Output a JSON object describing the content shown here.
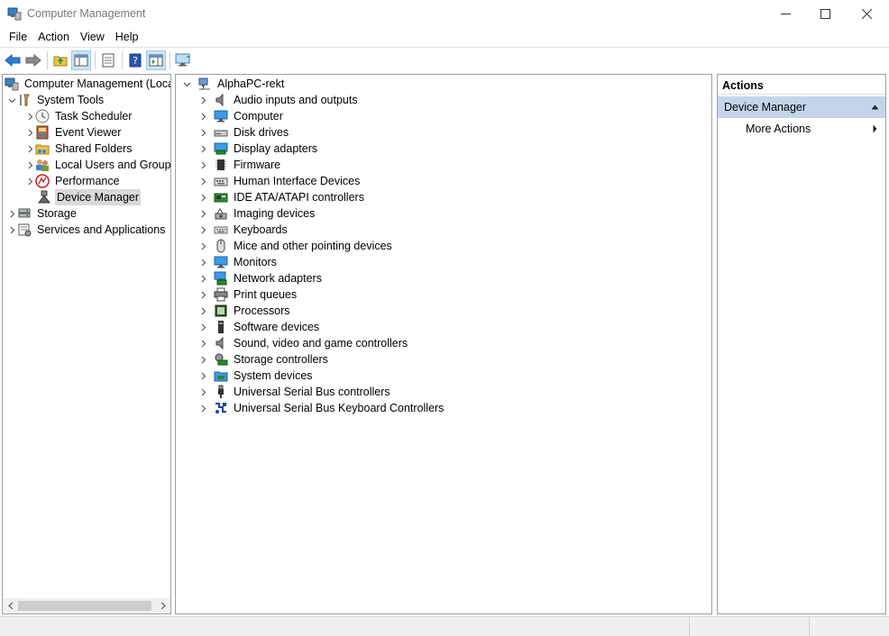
{
  "window": {
    "title": "Computer Management"
  },
  "window_controls": {
    "minimize": "—",
    "maximize": "☐",
    "close": "✕"
  },
  "menu": [
    "File",
    "Action",
    "View",
    "Help"
  ],
  "toolbar": {
    "buttons": [
      "back-icon",
      "forward-icon",
      "up-folder-icon",
      "show-hide-console-tree-icon",
      "properties-icon",
      "help-icon",
      "show-action-pane-icon",
      "monitor-icon"
    ]
  },
  "left_tree": {
    "items": [
      {
        "label": "Computer Management (Local",
        "expander": "",
        "icon": "computer-management-icon"
      },
      {
        "label": "System Tools",
        "expander": "v",
        "icon": "system-tools-icon"
      },
      {
        "label": "Task Scheduler",
        "expander": ">",
        "icon": "clock-icon"
      },
      {
        "label": "Event Viewer",
        "expander": ">",
        "icon": "event-viewer-icon"
      },
      {
        "label": "Shared Folders",
        "expander": ">",
        "icon": "shared-folders-icon"
      },
      {
        "label": "Local Users and Groups",
        "expander": ">",
        "icon": "users-icon"
      },
      {
        "label": "Performance",
        "expander": ">",
        "icon": "performance-icon"
      },
      {
        "label": "Device Manager",
        "expander": "",
        "icon": "device-manager-icon"
      },
      {
        "label": "Storage",
        "expander": ">",
        "icon": "storage-icon"
      },
      {
        "label": "Services and Applications",
        "expander": ">",
        "icon": "services-icon"
      }
    ]
  },
  "device_tree": {
    "root": {
      "label": "AlphaPC-rekt",
      "expander": "v"
    },
    "categories": [
      "Audio inputs and outputs",
      "Computer",
      "Disk drives",
      "Display adapters",
      "Firmware",
      "Human Interface Devices",
      "IDE ATA/ATAPI controllers",
      "Imaging devices",
      "Keyboards",
      "Mice and other pointing devices",
      "Monitors",
      "Network adapters",
      "Print queues",
      "Processors",
      "Software devices",
      "Sound, video and game controllers",
      "Storage controllers",
      "System devices",
      "Universal Serial Bus controllers",
      "Universal Serial Bus Keyboard Controllers"
    ],
    "expander": ">"
  },
  "actions": {
    "header": "Actions",
    "group": "Device Manager",
    "item": "More Actions"
  },
  "colors": {
    "selection_dim": "#d9d9d9",
    "actions_group_bg": "#c4d5ea",
    "pressed_button": "#cce4f7"
  }
}
